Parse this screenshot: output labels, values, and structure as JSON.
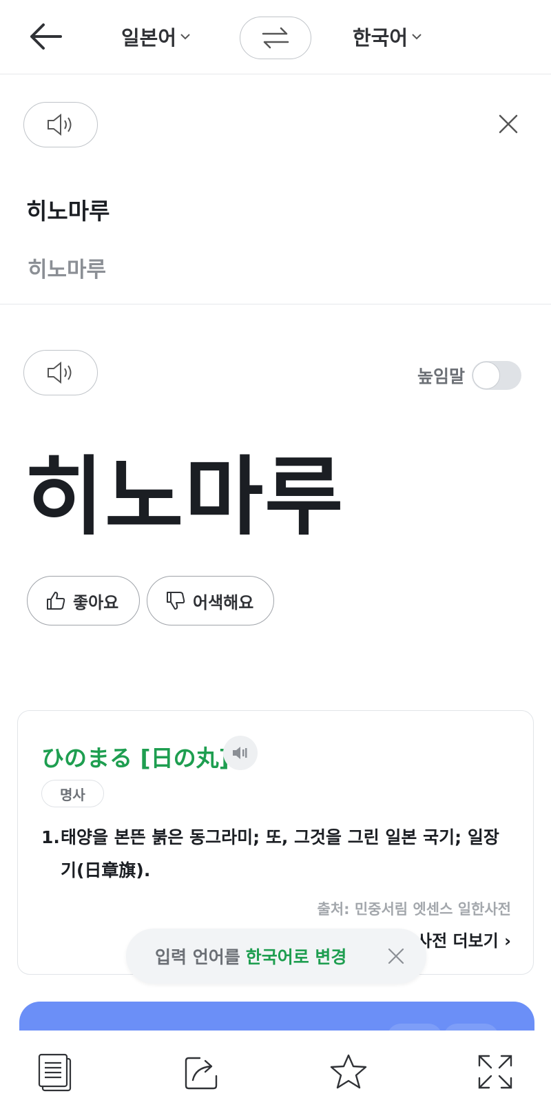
{
  "header": {
    "source_lang": "일본어",
    "target_lang": "한국어",
    "chevron": "⌄"
  },
  "source_panel": {
    "text": "히노마루",
    "pronunciation": "히노마루"
  },
  "result_panel": {
    "honorific_label": "높임말",
    "honorific_on": false,
    "translation": "히노마루",
    "like_label": "좋아요",
    "dislike_label": "어색해요"
  },
  "dictionary": {
    "word": "ひのまる [日の丸]",
    "part_of_speech": "명사",
    "meaning_number": "1.",
    "meaning_text": "태양을 본뜬 붉은 동그라미; 또, 그것을 그린 일본 국기; 일장기(日章旗).",
    "source": "출처: 민중서림 엣센스 일한사전",
    "more_label": "사전 더보기 ›"
  },
  "toast": {
    "prefix": "입력 언어를",
    "accent": "한국어로 변경"
  },
  "colors": {
    "accent_green": "#1e9e50",
    "blue_card": "#6b8ff7"
  },
  "bottom_bar": {
    "icons": [
      "document-icon",
      "share-icon",
      "star-icon",
      "fullscreen-icon"
    ]
  }
}
